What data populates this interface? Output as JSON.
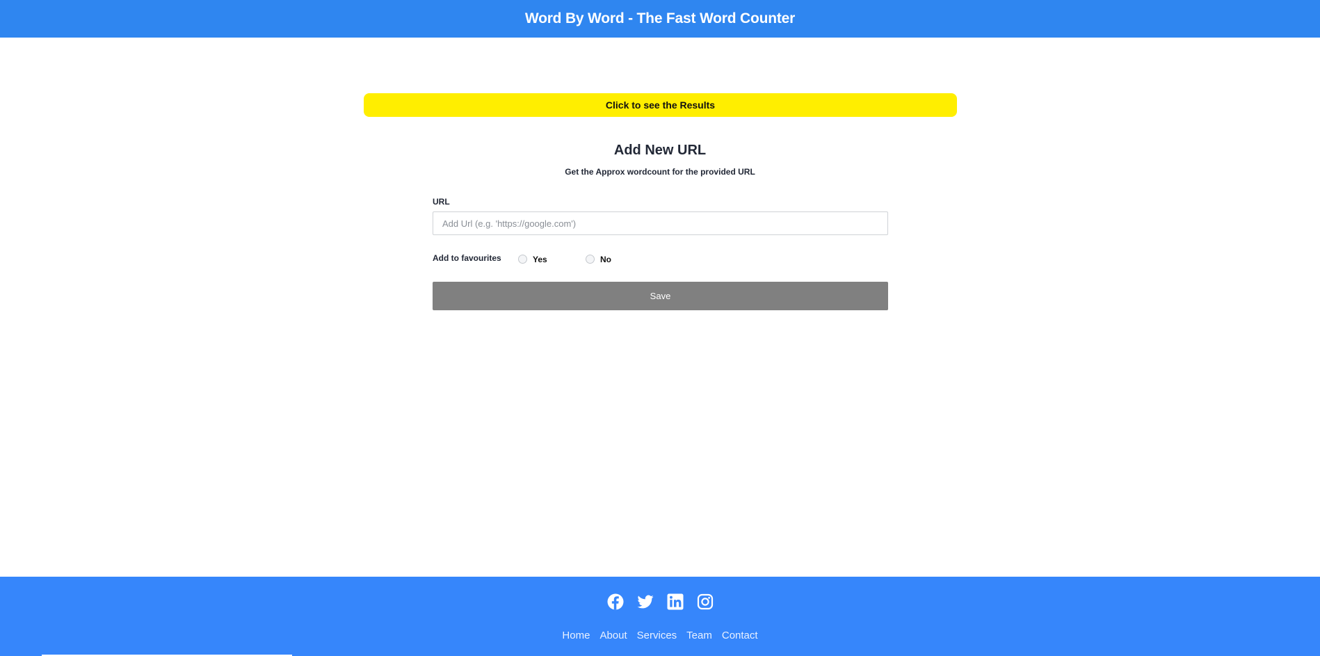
{
  "header": {
    "title": "Word By Word - The Fast Word Counter"
  },
  "results_button": {
    "label": "Click to see the Results"
  },
  "form": {
    "title": "Add New URL",
    "subtitle": "Get the Approx wordcount for the provided URL",
    "url_label": "URL",
    "url_placeholder": "Add Url (e.g. 'https://google.com')",
    "url_value": "",
    "favourites_label": "Add to favourites",
    "favourites_options": [
      "Yes",
      "No"
    ],
    "favourites_selected": null,
    "save_label": "Save"
  },
  "footer": {
    "social_icons": [
      "facebook-icon",
      "twitter-icon",
      "linkedin-icon",
      "instagram-icon"
    ],
    "nav_links": [
      "Home",
      "About",
      "Services",
      "Team",
      "Contact"
    ]
  },
  "colors": {
    "header_bg": "#2f86f0",
    "results_button_bg": "#ffee00",
    "save_button_bg": "#808080",
    "footer_bg": "#3686fb"
  }
}
